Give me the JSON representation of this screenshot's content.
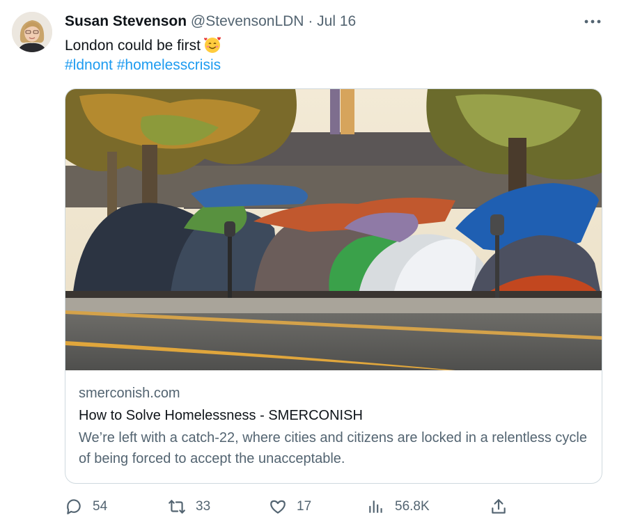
{
  "tweet": {
    "author_name": "Susan Stevenson",
    "handle": "@StevensonLDN",
    "separator": " · ",
    "date": "Jul 16",
    "text": "London could be first",
    "hashtags": [
      "#ldnont",
      "#homelesscrisis"
    ]
  },
  "card": {
    "domain": "smerconish.com",
    "title": "How to Solve Homelessness - SMERCONISH",
    "description": "We’re left with a catch-22, where cities and citizens are locked in a relentless cycle of being forced to accept the unacceptable."
  },
  "actions": {
    "replies": "54",
    "retweets": "33",
    "likes": "17",
    "views": "56.8K"
  },
  "icons": {
    "reply": "reply-icon",
    "retweet": "retweet-icon",
    "like": "heart-icon",
    "views": "views-icon",
    "share": "share-icon",
    "more": "more-icon"
  },
  "colors": {
    "link": "#1d9bf0",
    "secondary_text": "#536471",
    "border": "#cfd9de"
  }
}
